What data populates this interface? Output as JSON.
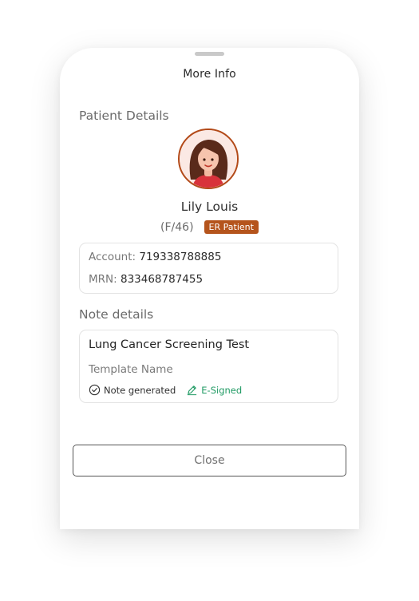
{
  "sheet": {
    "title": "More Info"
  },
  "patient": {
    "section_title": "Patient Details",
    "name": "Lily Louis",
    "gender_age": "(F/46)",
    "badge": "ER Patient",
    "account_label": "Account:",
    "account_value": "719338788885",
    "mrn_label": "MRN:",
    "mrn_value": "833468787455",
    "avatar_icon": "female-avatar-icon"
  },
  "note": {
    "section_title": "Note details",
    "name": "Lung Cancer Screening Test",
    "template": "Template Name",
    "status_generated": "Note generated",
    "status_signed": "E-Signed",
    "generated_icon": "check-circle-icon",
    "signed_icon": "pen-sign-icon"
  },
  "actions": {
    "close_label": "Close"
  },
  "colors": {
    "accent": "#b5541c",
    "signed_green": "#1f9a63",
    "border": "#e3e3e3"
  }
}
